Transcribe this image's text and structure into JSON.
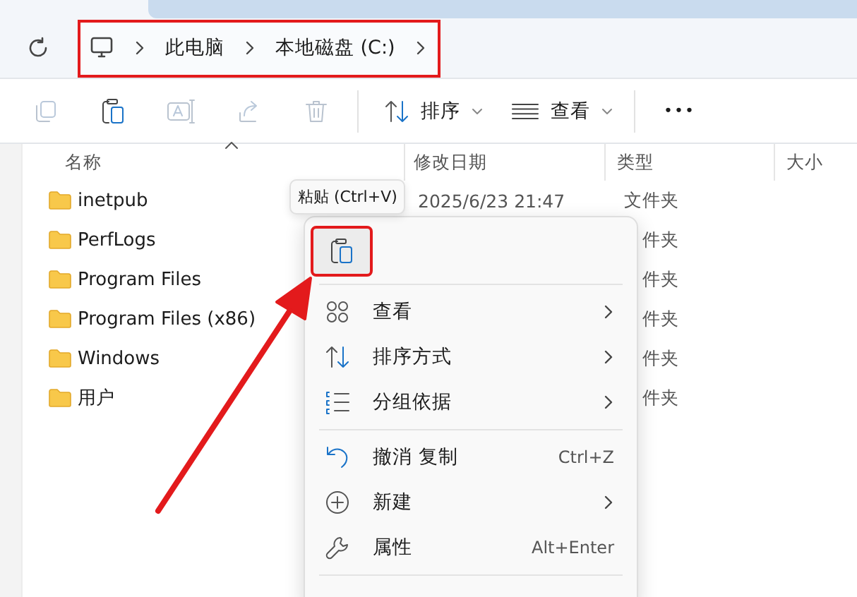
{
  "address": {
    "highlighted": true,
    "crumbs": [
      "此电脑",
      "本地磁盘 (C:)"
    ]
  },
  "toolbar": {
    "icons": [
      {
        "kind": "copy",
        "disabled": true
      },
      {
        "kind": "paste",
        "disabled": false
      },
      {
        "kind": "rename",
        "disabled": true
      },
      {
        "kind": "share",
        "disabled": true
      },
      {
        "kind": "delete",
        "disabled": true
      }
    ],
    "sort": "排序",
    "view": "查看",
    "more": "•••"
  },
  "columns": [
    "名称",
    "修改日期",
    "类型",
    "大小"
  ],
  "rows": [
    {
      "name": "inetpub",
      "modified": "2025/6/23 21:47",
      "type": "文件夹"
    },
    {
      "name": "PerfLogs",
      "type": "件夹"
    },
    {
      "name": "Program Files",
      "type": "件夹"
    },
    {
      "name": "Program Files (x86)",
      "type": "件夹"
    },
    {
      "name": "Windows",
      "type": "件夹"
    },
    {
      "name": "用户",
      "type": "件夹"
    }
  ],
  "context_menu": {
    "tooltip": "粘贴 (Ctrl+V)",
    "icon_buttons": [
      {
        "kind": "paste",
        "highlighted": true
      }
    ],
    "groups": [
      [
        {
          "kind": "view",
          "label": "查看",
          "submenu": true
        },
        {
          "kind": "sort",
          "label": "排序方式",
          "submenu": true
        },
        {
          "kind": "group",
          "label": "分组依据",
          "submenu": true
        }
      ],
      [
        {
          "kind": "undo",
          "label": "撤消 复制",
          "shortcut": "Ctrl+Z",
          "submenu": false
        },
        {
          "kind": "new",
          "label": "新建",
          "submenu": true
        },
        {
          "kind": "properties",
          "label": "属性",
          "shortcut": "Alt+Enter",
          "submenu": false
        }
      ]
    ],
    "annotation_arrow": true
  }
}
